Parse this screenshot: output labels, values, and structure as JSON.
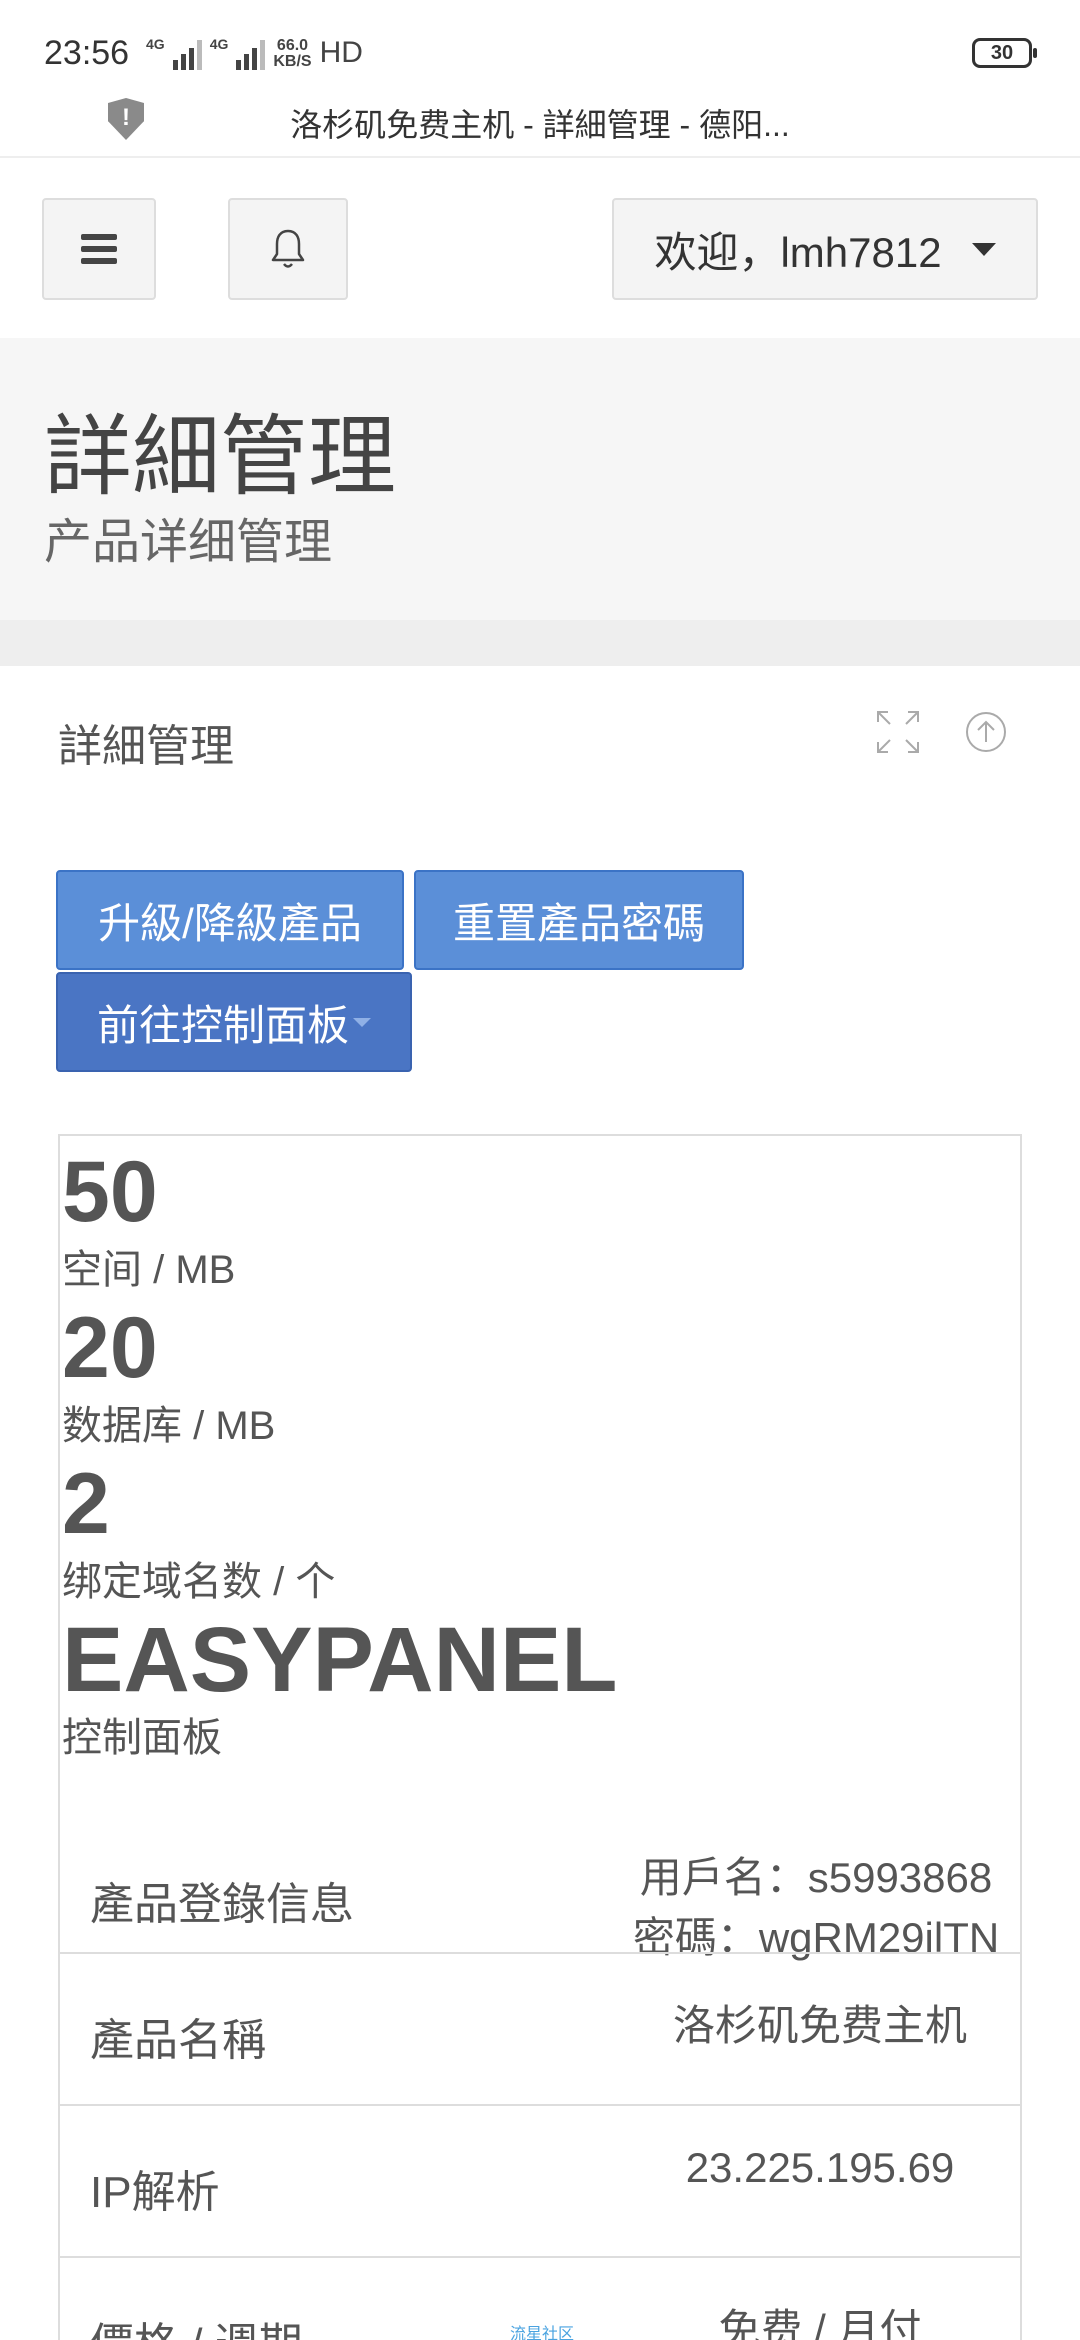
{
  "status_bar": {
    "time": "23:56",
    "network_tag_1": "4G",
    "network_tag_2": "4G",
    "speed_value": "66.0",
    "speed_unit": "KB/S",
    "hd_label": "HD",
    "battery": "30",
    "tab_title": "洛杉矶免费主机 - 詳細管理 - 德阳..."
  },
  "nav": {
    "menu_icon": "hamburger-icon",
    "bell_icon": "bell-icon",
    "welcome": "欢迎，lmh7812"
  },
  "page_header": {
    "title": "詳細管理",
    "subtitle": "产品详细管理"
  },
  "portlet": {
    "title": "詳細管理",
    "tools": [
      "fullscreen-icon",
      "collapse-icon"
    ],
    "buttons": {
      "upgrade": "升級/降級產品",
      "reset_password": "重置產品密碼",
      "control_panel": "前往控制面板"
    },
    "stats": [
      {
        "value": "50",
        "label": "空间 / MB"
      },
      {
        "value": "20",
        "label": "数据库 / MB"
      },
      {
        "value": "2",
        "label": "绑定域名数 / 个"
      },
      {
        "value": "EASYPANEL",
        "label": "控制面板"
      }
    ],
    "rows": {
      "login": {
        "label": "產品登錄信息",
        "username": "用戶名：s5993868",
        "password": "密碼：wgRM29ilTN"
      },
      "name": {
        "label": "產品名稱",
        "value": "洛杉矶免费主机"
      },
      "ip": {
        "label": "IP解析",
        "value": "23.225.195.69"
      },
      "price": {
        "label": "價格 / 週期",
        "value": "免费 / 月付",
        "watermark": "流星社区"
      }
    }
  },
  "colors": {
    "primary_button": "#5b8fd8",
    "primary_button_dark": "#4a75c4",
    "header_bg": "#f6f6f6"
  }
}
